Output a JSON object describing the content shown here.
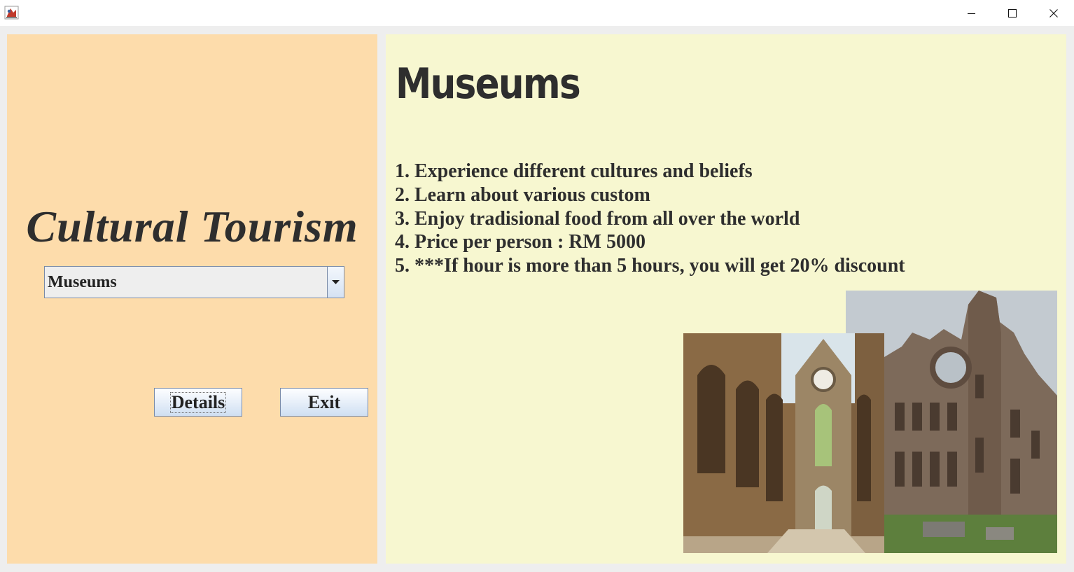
{
  "window": {
    "icon": "java-app-icon",
    "controls": {
      "minimize": "minimize-icon",
      "maximize": "maximize-icon",
      "close": "close-icon"
    }
  },
  "left": {
    "brand_title": "Cultural Tourism",
    "category_select": {
      "selected": "Museums",
      "arrow": "chevron-down-icon"
    },
    "details_button": "Details",
    "exit_button": "Exit",
    "colors": {
      "panel_bg": "#fddcab"
    }
  },
  "right": {
    "heading": "Museums",
    "features": [
      "1. Experience different cultures and beliefs",
      "2. Learn about various custom",
      "3. Enjoy tradisional food from all over the world",
      "4. Price per person : RM 5000",
      "5. ***If hour is more than 5 hours, you will get 20%  discount"
    ],
    "images": [
      "abbey-ruins-interior-photo",
      "cathedral-ruins-exterior-photo"
    ],
    "colors": {
      "panel_bg": "#f7f7d0"
    }
  }
}
